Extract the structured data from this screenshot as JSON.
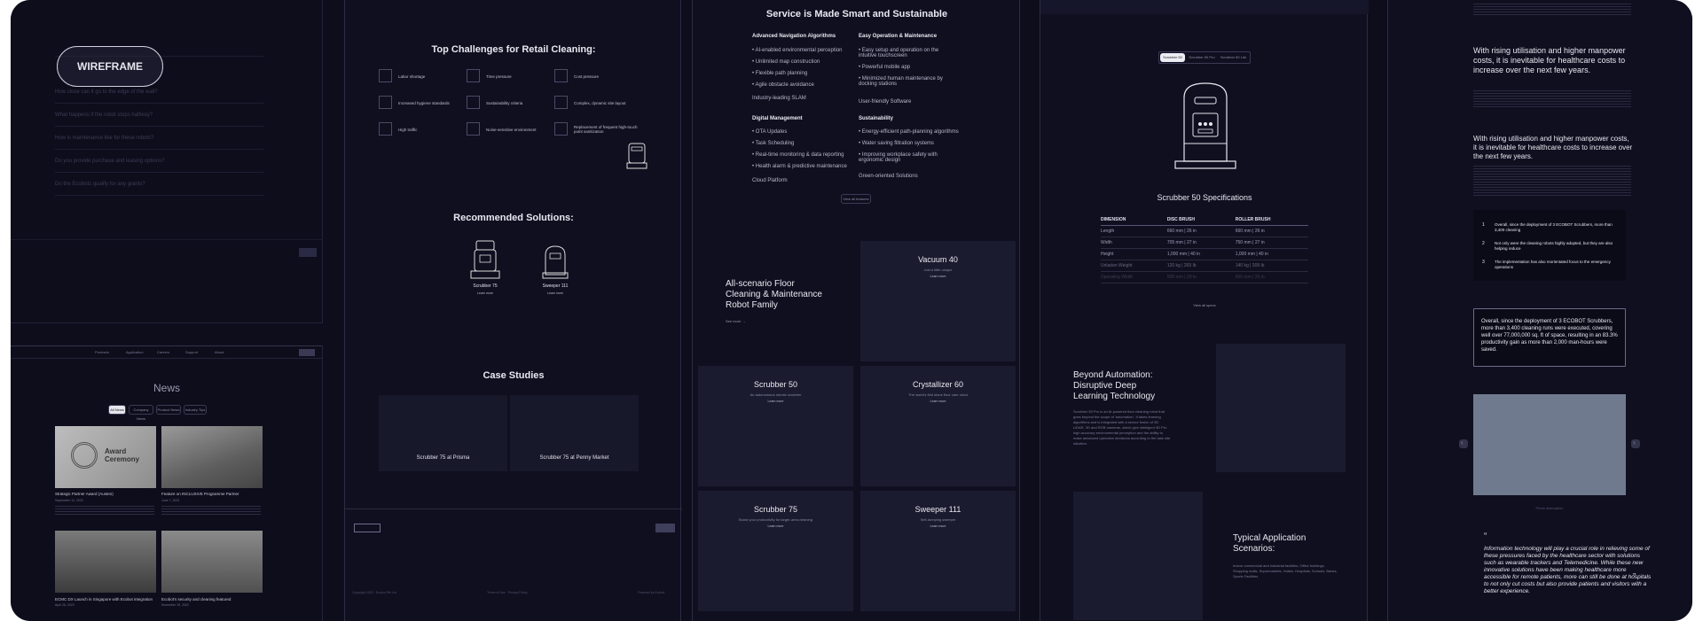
{
  "wireframe_badge": "WIREFRAME",
  "faq": {
    "items": [
      "How close can it go to the edge of the wall?",
      "What happens if the robot stops halfway?",
      "How is maintenance like for these robots?",
      "Do you provide purchase and leasing options?",
      "Do the Ecobots qualify for any grants?"
    ]
  },
  "news": {
    "title": "News",
    "filters": [
      "All News",
      "Company News",
      "Product News",
      "Industry Tips"
    ],
    "articles": [
      {
        "title": "Strategic Partner Award (Austen)",
        "date": "September 12, 2023",
        "image_text": "Award Ceremony"
      },
      {
        "title": "Feature on INCLUSIVE Programme Partner",
        "date": "June 7, 2023"
      },
      {
        "title": "ECMC DX Launch in Singapore with Ecobot integration",
        "date": "April 26, 2023"
      },
      {
        "title": "Ecobot's security and cleaning featured",
        "date": "November 15, 2022"
      }
    ],
    "nav": [
      "Products",
      "Application",
      "Careers",
      "Support",
      "About"
    ]
  },
  "retail": {
    "challenges_title": "Top Challenges for Retail Cleaning:",
    "challenges": [
      "Labor shortage",
      "Time pressure",
      "Cost pressure",
      "Increased hygiene standards",
      "Sustainability criteria",
      "Complex, dynamic site layout",
      "High traffic",
      "Noise-sensitive environment",
      "Replacement of frequent high-touch point sanitization"
    ],
    "recommended_title": "Recommended Solutions:",
    "solutions": [
      {
        "name": "Scrubber 75",
        "link": "Learn more"
      },
      {
        "name": "Sweeper 111",
        "link": "Learn more"
      }
    ],
    "case_title": "Case Studies",
    "cases": [
      "Scrubber 75 at Prisma",
      "Scrubber 75 at Penny Market"
    ],
    "footer_copy": "Copyright 2023 · Ecobot Pte Ltd",
    "footer_links": "Terms of Use · Privacy Policy",
    "footer_right": "Powered by Ecobot"
  },
  "service": {
    "title": "Service is Made Smart and Sustainable",
    "groups": [
      {
        "title": "Advanced Navigation Algorithms",
        "items": [
          "AI-enabled environmental perception",
          "Unlimited map construction",
          "Flexible path planning",
          "Agile obstacle avoidance"
        ],
        "tag": "Industry-leading SLAM"
      },
      {
        "title": "Easy Operation & Maintenance",
        "items": [
          "Easy setup and operation on the intuitive touchscreen",
          "Powerful mobile app",
          "Minimized human maintenance by docking stations"
        ],
        "tag": "User-friendly Software"
      },
      {
        "title": "Digital Management",
        "items": [
          "OTA Updates",
          "Task Scheduling",
          "Real-time monitoring & data reporting",
          "Health alarm & predictive maintenance"
        ],
        "tag": "Cloud Platform"
      },
      {
        "title": "Sustainability",
        "items": [
          "Energy-efficient path-planning algorithms",
          "Water saving filtration systems",
          "Improving workplace safety with ergonomic design"
        ],
        "tag": "Green-oriented Solutions"
      }
    ],
    "button": "View all features",
    "family_title": "All-scenario Floor Cleaning & Maintenance Robot Family",
    "family_link": "See more",
    "products": [
      {
        "name": "Vacuum 40",
        "sub": "Just a little unique",
        "link": "Learn more"
      },
      {
        "name": "Scrubber 50",
        "sub": "An autonomous robotic scrubber",
        "link": "Learn more"
      },
      {
        "name": "Crystallizer 60",
        "sub": "The world's first stone floor care robot",
        "link": "Learn more"
      },
      {
        "name": "Scrubber 75",
        "sub": "Boost your productivity for larger-area cleaning",
        "link": "Learn more"
      },
      {
        "name": "Sweeper 111",
        "sub": "Self-dumping sweeper",
        "link": "Learn more"
      }
    ]
  },
  "scrubber": {
    "tabs": [
      "Scrubber 50",
      "Scrubber 50 Pro",
      "Scrubber 50 Lite"
    ],
    "spec_title": "Scrubber 50 Specifications",
    "spec_headers": [
      "DIMENSION",
      "DISC BRUSH",
      "ROLLER BRUSH"
    ],
    "spec_rows": [
      [
        "Length",
        "660 mm | 26 in",
        "660 mm | 26 in"
      ],
      [
        "Width",
        "705 mm | 27 in",
        "750 mm | 27 in"
      ],
      [
        "Height",
        "1,000 mm | 40 in",
        "1,000 mm | 40 in"
      ],
      [
        "Unladen Weight",
        "120 kg | 265 lb",
        "140 kg | 309 lb"
      ],
      [
        "Operating Width",
        "500 mm | 20 in",
        "500 mm | 20 in"
      ],
      [
        "Working Capacity",
        "",
        "",
        ""
      ]
    ],
    "spec_link": "View all specs",
    "beyond_title": "Beyond Automation: Disruptive Deep Learning Technology",
    "beyond_text": "Scrubber 50 Pro is an AI-powered floor cleaning robot that goes beyond the scope of 'automation'. It takes learning algorithms and is integrated with a sensor fusion of 3D LiDAR, 3D and RGB cameras, which give intelligent 3D Pro high accuracy environmental perception and the ability to make advanced operation decisions according to the task site situation.",
    "typical_title": "Typical Application Scenarios:",
    "typical_text": "Indoor commercial and industrial facilities, Office buildings, Shopping malls, Supermarkets, Hotels, Hospitals, Schools, Banks, Sports Facilities"
  },
  "health": {
    "heading1": "With rising utilisation and higher manpower costs, it is inevitable for healthcare costs to increase over the next few years.",
    "heading2": "With rising utilisation and higher manpower costs, it is inevitable for healthcare costs to increase over the next few years.",
    "list": [
      {
        "n": "1",
        "text": "Overall, since the deployment of 3 ECOBOT Scrubbers, more than 3,400 cleaning"
      },
      {
        "n": "2",
        "text": "Not only were the cleaning robots highly adopted, but they are also helping reduce"
      },
      {
        "n": "3",
        "text": "The implementation has also reorientated focus to the emergency operations"
      }
    ],
    "highlight": "Overall, since the deployment of 3 ECOBOT Scrubbers, more than 3,400 cleaning runs were executed, covering well over 77,000,000 sq. ft of space, resulting in an 83.3% productivity gain as more than 2,000 man-hours were saved.",
    "caption": "Photo description",
    "quote": "Information technology will play a crucial role in relieving some of these pressures faced by the healthcare sector with solutions such as wearable trackers and Telemedicine. While these new innovative solutions have been making healthcare more accessible for remote patients, more can still be done at hospitals to not only cut costs but also provide patients and visitors with a better experience."
  }
}
